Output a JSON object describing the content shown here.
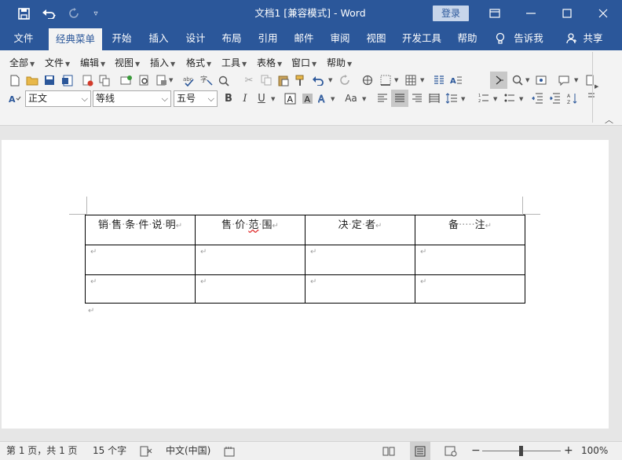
{
  "window": {
    "title": "文档1 [兼容模式] - Word",
    "signin_label": "登录"
  },
  "tabs": [
    "文件",
    "经典菜单",
    "开始",
    "插入",
    "设计",
    "布局",
    "引用",
    "邮件",
    "审阅",
    "视图",
    "开发工具",
    "帮助",
    "告诉我",
    "共享"
  ],
  "active_tab": "经典菜单",
  "classic_menu": [
    "全部",
    "文件",
    "编辑",
    "视图",
    "插入",
    "格式",
    "工具",
    "表格",
    "窗口",
    "帮助"
  ],
  "format_bar": {
    "style_value": "正文",
    "font_value": "等线",
    "size_value": "五号",
    "case_label": "Aa"
  },
  "document": {
    "table": {
      "headers": [
        "销·售·条·件·说·明",
        "售·价·范·围",
        "决·定·者",
        "备·····注"
      ],
      "rows": [
        [
          "",
          "",
          "",
          ""
        ],
        [
          "",
          "",
          "",
          ""
        ]
      ]
    }
  },
  "status": {
    "page": "第 1 页，共 1 页",
    "words": "15 个字",
    "language": "中文(中国)",
    "zoom": "100%"
  },
  "colors": {
    "accent": "#2b579a",
    "ribbon_bg": "#f3f3f3",
    "status_bg": "#f0f0f0"
  }
}
